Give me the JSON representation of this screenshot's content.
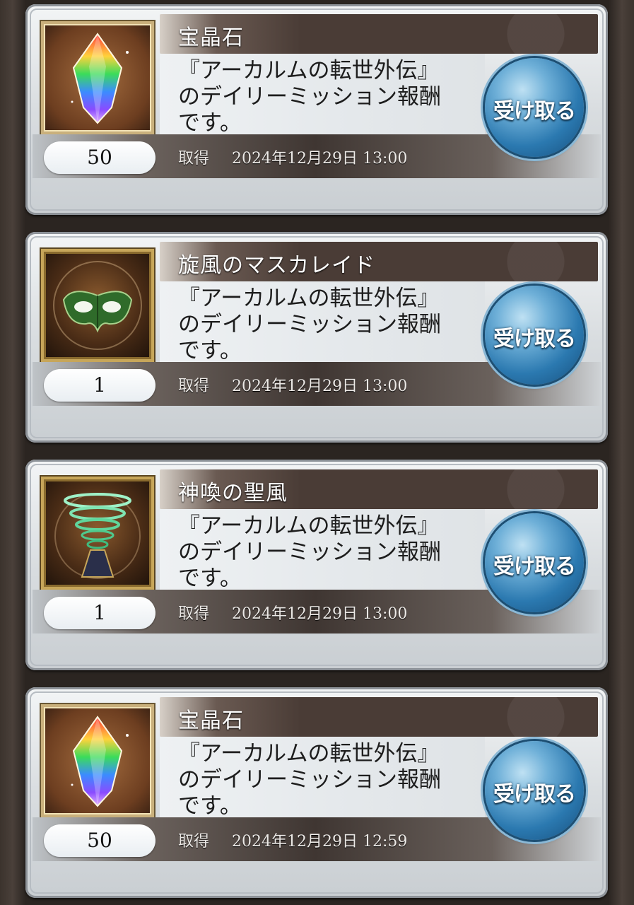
{
  "items": [
    {
      "name": "宝晶石",
      "icon": "crystal-icon",
      "description": "『アーカルムの転世外伝』\nのデイリーミッション報酬\nです。",
      "quantity": "50",
      "got_label": "取得",
      "got_time": "2024年12月29日 13:00",
      "button_label": "受け取る"
    },
    {
      "name": "旋風のマスカレイド",
      "icon": "mask-icon",
      "description": "『アーカルムの転世外伝』\nのデイリーミッション報酬\nです。",
      "quantity": "1",
      "got_label": "取得",
      "got_time": "2024年12月29日 13:00",
      "button_label": "受け取る"
    },
    {
      "name": "神喚の聖風",
      "icon": "whirlwind-icon",
      "description": "『アーカルムの転世外伝』\nのデイリーミッション報酬\nです。",
      "quantity": "1",
      "got_label": "取得",
      "got_time": "2024年12月29日 13:00",
      "button_label": "受け取る"
    },
    {
      "name": "宝晶石",
      "icon": "crystal-icon",
      "description": "『アーカルムの転世外伝』\nのデイリーミッション報酬\nです。",
      "quantity": "50",
      "got_label": "取得",
      "got_time": "2024年12月29日 12:59",
      "button_label": "受け取る"
    }
  ],
  "colors": {
    "button_blue": "#2b79b0",
    "title_band": "#4a3c36",
    "card_silver": "#d9dde0"
  }
}
